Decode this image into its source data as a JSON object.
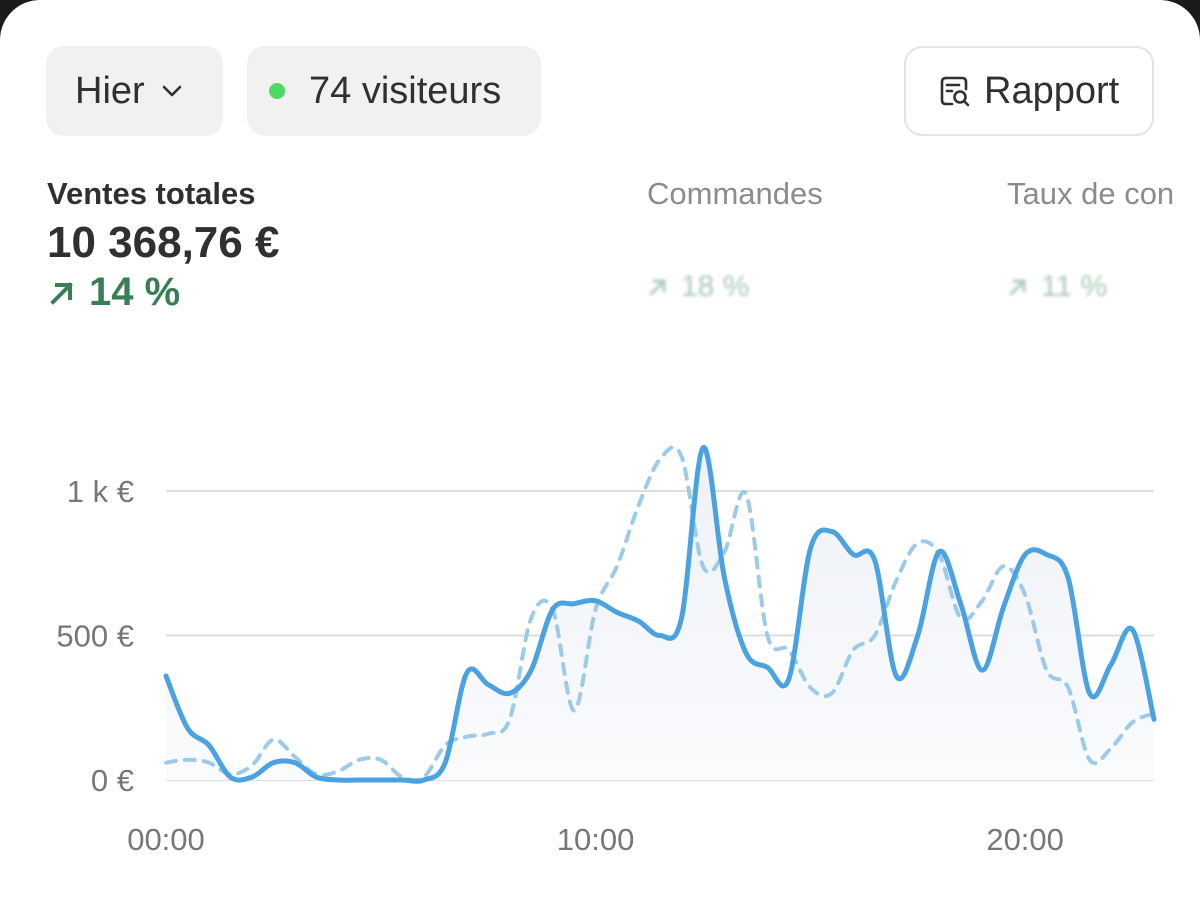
{
  "toolbar": {
    "period_label": "Hier",
    "visitors_label": "74 visiteurs",
    "report_label": "Rapport"
  },
  "metrics": {
    "sales": {
      "label": "Ventes totales",
      "value": "10 368,76 €",
      "delta": "14 %"
    },
    "orders": {
      "label": "Commandes",
      "delta": "18 %"
    },
    "conversion": {
      "label": "Taux de con",
      "delta": "11 %"
    }
  },
  "colors": {
    "accent_line": "#4aa3e0",
    "positive": "#3b7d55",
    "live_dot": "#4cd964"
  },
  "chart_data": {
    "type": "line",
    "ylim": [
      0,
      1200
    ],
    "y_ticks": [
      "0 €",
      "500 €",
      "1 k €"
    ],
    "y_tick_values": [
      0,
      500,
      1000
    ],
    "x_ticks": [
      "00:00",
      "10:00",
      "20:00"
    ],
    "x_tick_values": [
      0,
      10,
      20
    ],
    "series": [
      {
        "style": "solid",
        "x": [
          0,
          0.5,
          1,
          1.5,
          2,
          2.5,
          3,
          3.5,
          4,
          4.5,
          5,
          5.5,
          6,
          6.5,
          7,
          7.5,
          8,
          8.5,
          9,
          9.5,
          10,
          10.5,
          11,
          11.5,
          12,
          12.5,
          13,
          13.5,
          14,
          14.5,
          15,
          15.5,
          16,
          16.5,
          17,
          17.5,
          18,
          18.5,
          19,
          19.5,
          20,
          20.5,
          21,
          21.5,
          22,
          22.5,
          23
        ],
        "values": [
          360,
          180,
          120,
          10,
          10,
          60,
          60,
          10,
          0,
          0,
          0,
          0,
          0,
          60,
          370,
          330,
          300,
          380,
          590,
          610,
          620,
          580,
          550,
          500,
          560,
          1150,
          700,
          440,
          390,
          350,
          800,
          860,
          780,
          760,
          360,
          500,
          790,
          610,
          380,
          600,
          780,
          780,
          700,
          300,
          400,
          520,
          210
        ]
      },
      {
        "style": "dashed",
        "x": [
          0,
          0.5,
          1,
          1.5,
          2,
          2.5,
          3,
          3.5,
          4,
          4.5,
          5,
          5.5,
          6,
          6.5,
          7,
          7.5,
          8,
          8.5,
          9,
          9.5,
          10,
          10.5,
          11,
          11.5,
          12,
          12.5,
          13,
          13.5,
          14,
          14.5,
          15,
          15.5,
          16,
          16.5,
          17,
          17.5,
          18,
          18.5,
          19,
          19.5,
          20,
          20.5,
          21,
          21.5,
          22,
          22.5,
          23
        ],
        "values": [
          60,
          70,
          60,
          20,
          50,
          140,
          80,
          20,
          30,
          70,
          70,
          10,
          10,
          120,
          150,
          160,
          210,
          560,
          590,
          240,
          590,
          740,
          950,
          1110,
          1120,
          740,
          790,
          990,
          500,
          450,
          320,
          300,
          450,
          500,
          690,
          820,
          780,
          560,
          620,
          740,
          640,
          380,
          320,
          70,
          110,
          200,
          230
        ]
      }
    ]
  }
}
